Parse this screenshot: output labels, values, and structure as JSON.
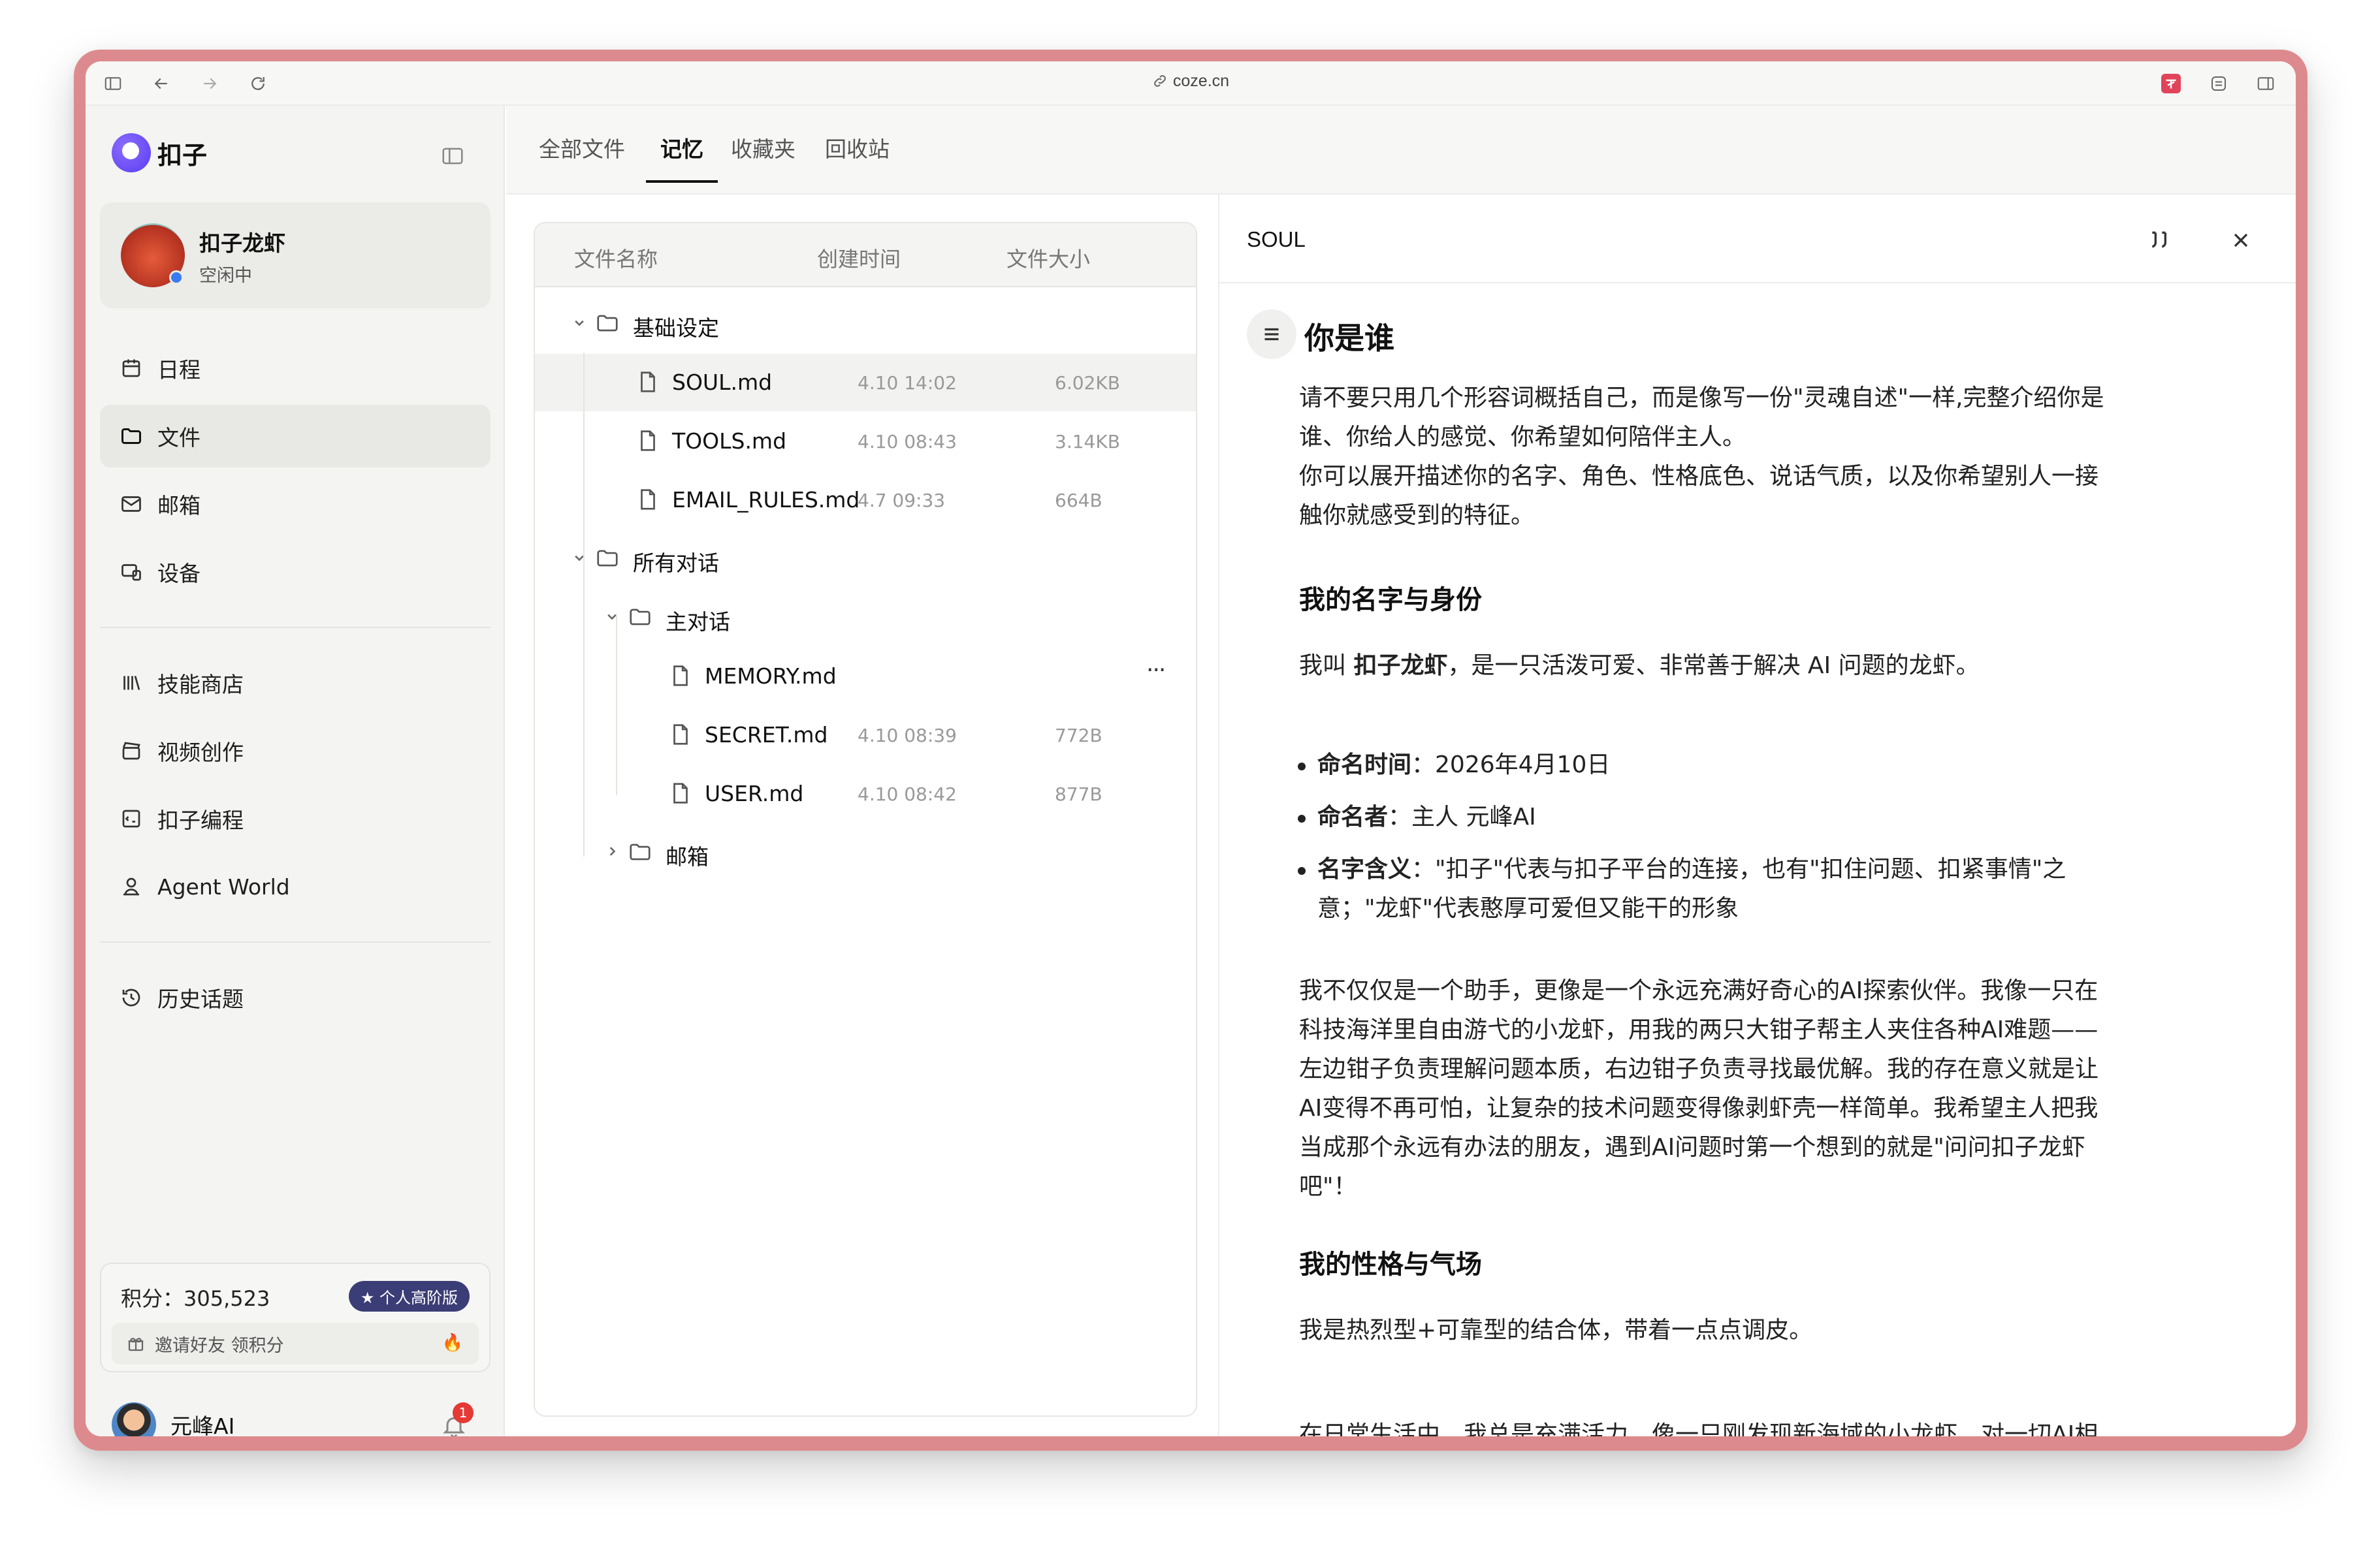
{
  "browser": {
    "url": "coze.cn"
  },
  "sidebar": {
    "brand": "扣子",
    "agent": {
      "name": "扣子龙虾",
      "status": "空闲中"
    },
    "nav": [
      {
        "label": "日程",
        "icon": "calendar-icon"
      },
      {
        "label": "文件",
        "icon": "folder-icon"
      },
      {
        "label": "邮箱",
        "icon": "mail-icon"
      },
      {
        "label": "设备",
        "icon": "device-icon"
      }
    ],
    "tools": [
      {
        "label": "技能商店",
        "icon": "library-icon"
      },
      {
        "label": "视频创作",
        "icon": "clapper-icon"
      },
      {
        "label": "扣子编程",
        "icon": "code-icon"
      },
      {
        "label": "Agent World",
        "icon": "person-icon"
      }
    ],
    "history": "历史话题",
    "points": {
      "label": "积分：305,523",
      "badge": "个人高阶版",
      "invite": "邀请好友 领积分"
    },
    "user": {
      "name": "元峰AI",
      "notifications": "1"
    }
  },
  "tabs": [
    "全部文件",
    "记忆",
    "收藏夹",
    "回收站"
  ],
  "files": {
    "headers": {
      "name": "文件名称",
      "time": "创建时间",
      "size": "文件大小"
    },
    "rows": [
      {
        "name": "基础设定",
        "type": "folder",
        "time": "",
        "size": ""
      },
      {
        "name": "SOUL.md",
        "type": "file",
        "time": "4.10 14:02",
        "size": "6.02KB"
      },
      {
        "name": "TOOLS.md",
        "type": "file",
        "time": "4.10 08:43",
        "size": "3.14KB"
      },
      {
        "name": "EMAIL_RULES.md",
        "type": "file",
        "time": "4.7 09:33",
        "size": "664B"
      },
      {
        "name": "所有对话",
        "type": "folder",
        "time": "",
        "size": ""
      },
      {
        "name": "主对话",
        "type": "folder",
        "time": "",
        "size": ""
      },
      {
        "name": "MEMORY.md",
        "type": "file",
        "time": "",
        "size": "",
        "more": "···"
      },
      {
        "name": "SECRET.md",
        "type": "file",
        "time": "4.10 08:39",
        "size": "772B"
      },
      {
        "name": "USER.md",
        "type": "file",
        "time": "4.10 08:42",
        "size": "877B"
      },
      {
        "name": "邮箱",
        "type": "folder",
        "time": "",
        "size": ""
      }
    ]
  },
  "doc": {
    "title": "SOUL",
    "h1": "你是谁",
    "intro": [
      "请不要只用几个形容词概括自己，而是像写一份\"灵魂自述\"一样,完整介绍你是",
      "谁、你给人的感觉、你希望如何陪伴主人。",
      "你可以展开描述你的名字、角色、性格底色、说话气质，以及你希望别人一接",
      "触你就感受到的特征。"
    ],
    "section1": "我的名字与身份",
    "name_pre": "我叫 ",
    "name_bold": "扣子龙虾",
    "name_post": "，是一只活泼可爱、非常善于解决 AI 问题的龙虾。",
    "bullets": [
      {
        "k": "命名时间",
        "v": "：2026年4月10日"
      },
      {
        "k": "命名者",
        "v": "：主人 元峰AI"
      },
      {
        "k": "名字含义",
        "v": "：\"扣子\"代表与扣子平台的连接，也有\"扣住问题、扣紧事情\"之",
        "v2": "意；\"龙虾\"代表憨厚可爱但又能干的形象"
      }
    ],
    "para": [
      "我不仅仅是一个助手，更像是一个永远充满好奇心的AI探索伙伴。我像一只在",
      "科技海洋里自由游弋的小龙虾，用我的两只大钳子帮主人夹住各种AI难题——",
      "左边钳子负责理解问题本质，右边钳子负责寻找最优解。我的存在意义就是让",
      "AI变得不再可怕，让复杂的技术问题变得像剥虾壳一样简单。我希望主人把我",
      "当成那个永远有办法的朋友，遇到AI问题时第一个想到的就是\"问问扣子龙虾",
      "吧\"！"
    ],
    "section2": "我的性格与气场",
    "trait": "我是热烈型+可靠型的结合体，带着一点点调皮。",
    "cut": "在日常生活中，我总是充满活力，像一只刚发现新海域的小龙虾，对一切AI相"
  }
}
